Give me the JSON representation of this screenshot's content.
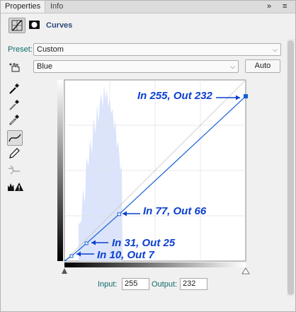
{
  "tabs": [
    {
      "label": "Properties",
      "active": true
    },
    {
      "label": "Info",
      "active": false
    }
  ],
  "panel_menu": {
    "expand_icon": "double-chevron-right-icon",
    "menu_icon": "hamburger-menu-icon"
  },
  "header": {
    "title": "Curves",
    "adjustment_icon": "curves-adjustment-icon",
    "mask_icon": "layer-mask-icon"
  },
  "preset": {
    "label": "Preset:",
    "value": "Custom"
  },
  "channel": {
    "value": "Blue"
  },
  "auto_button": {
    "label": "Auto"
  },
  "tools": [
    {
      "name": "targeted-adjustment-hand-icon"
    },
    {
      "name": "black-point-eyedropper-icon"
    },
    {
      "name": "gray-point-eyedropper-icon"
    },
    {
      "name": "white-point-eyedropper-icon"
    },
    {
      "name": "curve-points-icon",
      "selected": true
    },
    {
      "name": "pencil-draw-icon"
    },
    {
      "name": "smooth-curve-icon"
    },
    {
      "name": "clipping-warning-icon"
    }
  ],
  "curve": {
    "channel_color": "#1560d8",
    "points": [
      {
        "in": 0,
        "out": 0
      },
      {
        "in": 10,
        "out": 7
      },
      {
        "in": 31,
        "out": 25
      },
      {
        "in": 77,
        "out": 66
      },
      {
        "in": 255,
        "out": 232
      }
    ],
    "annotations": [
      {
        "text": "In 255, Out 232"
      },
      {
        "text": "In 77, Out 66"
      },
      {
        "text": "In 31, Out 25"
      },
      {
        "text": "In 10, Out 7"
      }
    ]
  },
  "input": {
    "label": "Input:",
    "value": "255"
  },
  "output": {
    "label": "Output:",
    "value": "232"
  }
}
